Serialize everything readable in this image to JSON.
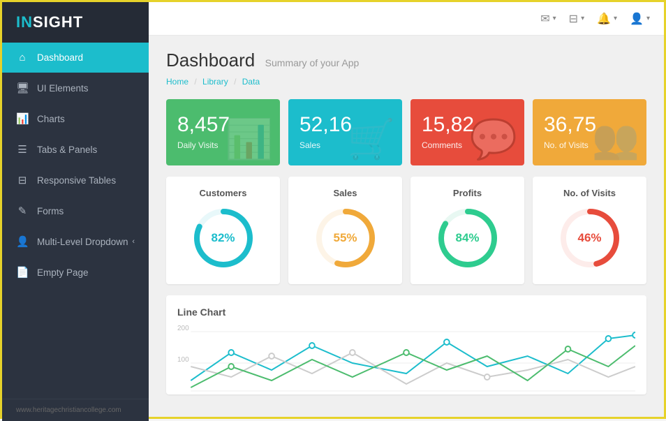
{
  "logo": {
    "in": "IN",
    "sight": "SIGHT"
  },
  "sidebar": {
    "items": [
      {
        "id": "dashboard",
        "label": "Dashboard",
        "icon": "⌂",
        "active": true
      },
      {
        "id": "ui-elements",
        "label": "UI Elements",
        "icon": "🖥",
        "active": false
      },
      {
        "id": "charts",
        "label": "Charts",
        "icon": "📊",
        "active": false
      },
      {
        "id": "tabs-panels",
        "label": "Tabs & Panels",
        "icon": "☰",
        "active": false
      },
      {
        "id": "responsive-tables",
        "label": "Responsive Tables",
        "icon": "⊟",
        "active": false
      },
      {
        "id": "forms",
        "label": "Forms",
        "icon": "✎",
        "active": false
      },
      {
        "id": "multi-level",
        "label": "Multi-Level Dropdown",
        "icon": "👤",
        "active": false,
        "arrow": "‹"
      },
      {
        "id": "empty-page",
        "label": "Empty Page",
        "icon": "📄",
        "active": false
      }
    ],
    "footer": "www.heritagechristiancollege.com"
  },
  "topbar": {
    "icons": [
      {
        "id": "email",
        "icon": "✉",
        "caret": "▾"
      },
      {
        "id": "menu",
        "icon": "⊟",
        "caret": "▾"
      },
      {
        "id": "bell",
        "icon": "🔔",
        "caret": "▾"
      },
      {
        "id": "user",
        "icon": "👤",
        "caret": "▾"
      }
    ]
  },
  "page": {
    "title": "Dashboard",
    "subtitle": "Summary of your App",
    "breadcrumb": [
      "Home",
      "Library",
      "Data"
    ]
  },
  "stat_cards": [
    {
      "id": "daily-visits",
      "number": "8,457",
      "label": "Daily Visits",
      "color": "green",
      "icon": "📊"
    },
    {
      "id": "sales",
      "number": "52,16",
      "label": "Sales",
      "color": "teal",
      "icon": "🛒"
    },
    {
      "id": "comments",
      "number": "15,82",
      "label": "Comments",
      "color": "red",
      "icon": "💬"
    },
    {
      "id": "no-of-visits",
      "number": "36,75",
      "label": "No. of Visits",
      "color": "orange",
      "icon": "👥"
    }
  ],
  "donut_panels": [
    {
      "id": "customers",
      "title": "Customers",
      "percent": 82,
      "color": "#1cbdcc",
      "bg_color": "#e8f8fa",
      "label": "82%"
    },
    {
      "id": "sales",
      "title": "Sales",
      "percent": 55,
      "color": "#f0a93a",
      "bg_color": "#fdf4e7",
      "label": "55%"
    },
    {
      "id": "profits",
      "title": "Profits",
      "percent": 84,
      "color": "#2ecc8f",
      "bg_color": "#e8f8f2",
      "label": "84%"
    },
    {
      "id": "no-of-visits",
      "title": "No. of Visits",
      "percent": 46,
      "color": "#e74c3c",
      "bg_color": "#fdecea",
      "label": "46%"
    }
  ],
  "line_chart": {
    "title": "Line Chart",
    "y_labels": [
      "200",
      "100"
    ],
    "colors": [
      "#1cbdcc",
      "#e8e8e8",
      "#4cbc6e"
    ]
  }
}
